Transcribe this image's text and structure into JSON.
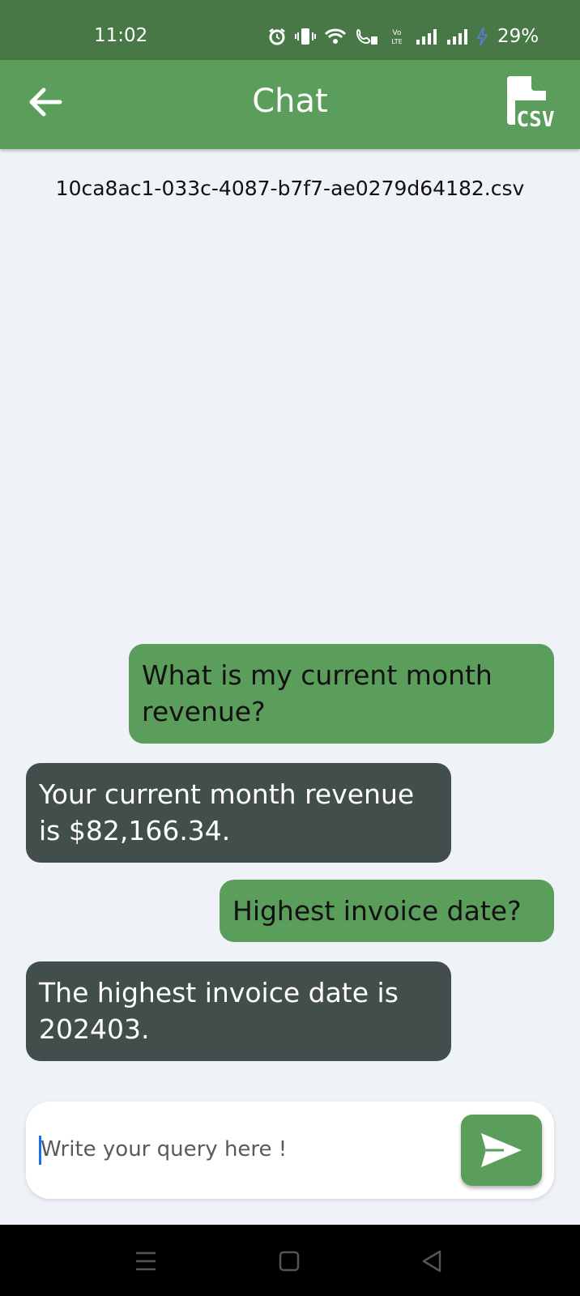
{
  "status_bar": {
    "time": "11:02",
    "battery": "29%",
    "icons": [
      "alarm-icon",
      "vibrate-icon",
      "wifi-icon",
      "wifi-call-icon",
      "volte-icon",
      "signal-icon",
      "signal-icon",
      "charging-icon"
    ]
  },
  "app_bar": {
    "title": "Chat",
    "back_icon": "arrow-left-icon",
    "action_icon": "csv-file-icon",
    "action_label": "CSV"
  },
  "file_name": "10ca8ac1-033c-4087-b7f7-ae0279d64182.csv",
  "messages": [
    {
      "role": "user",
      "text": "What is my current month\nrevenue?"
    },
    {
      "role": "bot",
      "text": "Your current month revenue\nis $82,166.34."
    },
    {
      "role": "user",
      "text": "Highest invoice date?"
    },
    {
      "role": "bot",
      "text": "The highest invoice date is\n202403."
    }
  ],
  "input": {
    "placeholder": "Write your query here !",
    "value": "",
    "send_icon": "send-icon"
  },
  "nav_bar": {
    "icons": [
      "recents-icon",
      "home-icon",
      "back-triangle-icon"
    ]
  },
  "colors": {
    "status_bar": "#477845",
    "app_bar": "#5b9e5b",
    "user_bubble": "#5b9e5b",
    "bot_bubble": "#424e4c",
    "background": "#eff3f8"
  }
}
